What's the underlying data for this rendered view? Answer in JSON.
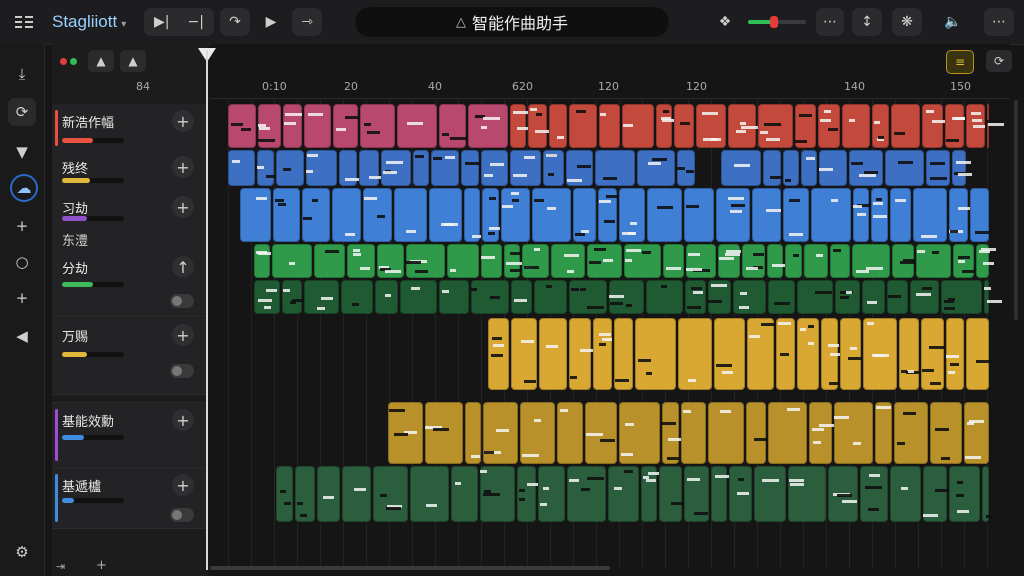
{
  "app": {
    "name": "Stagliiott",
    "title": "智能作曲助手"
  },
  "toolbar": {
    "menu_icon": "menu-icon",
    "transport": [
      "rewind-icon",
      "back-icon",
      "loop-icon",
      "play-icon",
      "record-icon"
    ],
    "right_icons": [
      "library-icon",
      "more-icon",
      "tuner-icon",
      "settings-icon",
      "volume-icon",
      "options-icon"
    ],
    "master_volume": 0.45
  },
  "left_rail": [
    "download-icon",
    "loop-region-icon",
    "filter-icon",
    "ai-assistant-icon",
    "add-icon",
    "instrument-icon",
    "add-track-icon",
    "collapse-icon",
    "settings-icon"
  ],
  "ruler": {
    "bar_label": "84",
    "ticks": [
      "0:10",
      "20",
      "40",
      "620",
      "120",
      "120",
      "140",
      "150"
    ]
  },
  "tracks": [
    {
      "name": "新浩作幅",
      "color": "#e8533f",
      "level": 0.5
    },
    {
      "name": "残终",
      "color": "#e0b93a",
      "level": 0.45
    },
    {
      "name": "习劫",
      "color": "#8d52c9",
      "level": 0.4,
      "sub": "东澧"
    },
    {
      "name": "分劫",
      "color": "#3fba5a",
      "level": 0.5
    },
    {
      "name": "万赐",
      "color": "#e0b93a",
      "level": 0.4
    },
    {
      "name": "基能效勳",
      "color": "#3f8de0",
      "level": 0.35
    },
    {
      "name": "基遞櫨",
      "color": "#3f8de0",
      "level": 0.2
    }
  ]
}
